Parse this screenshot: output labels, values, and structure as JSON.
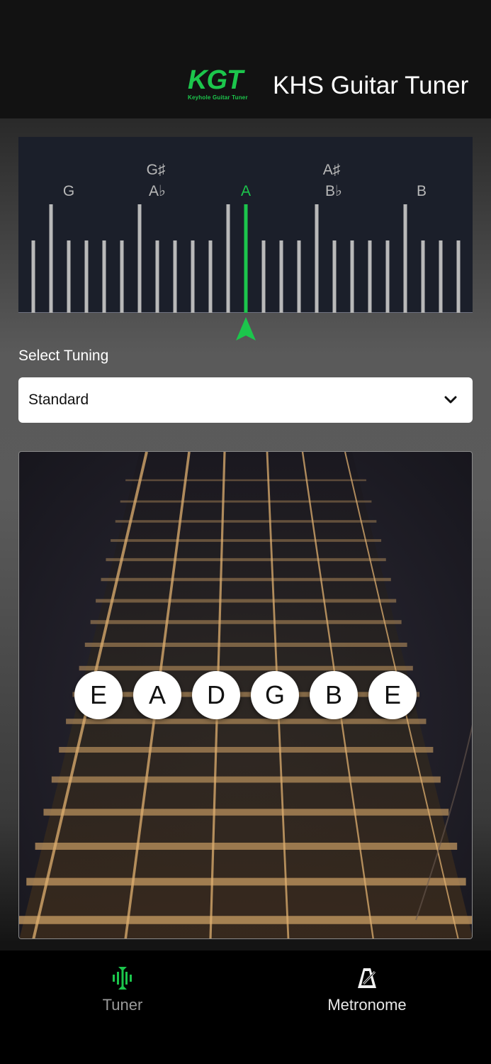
{
  "header": {
    "logo_text": "KGT",
    "logo_subtitle": "Keyhole Guitar Tuner",
    "title": "KHS Guitar Tuner"
  },
  "tuner": {
    "labels": {
      "g": "G",
      "ab_sharp": "G♯",
      "ab_flat": "A♭",
      "a": "A",
      "bb_sharp": "A♯",
      "bb_flat": "B♭",
      "b": "B"
    },
    "active_note": "A",
    "accent_color": "#1cc64c"
  },
  "select_tuning": {
    "label": "Select Tuning",
    "value": "Standard"
  },
  "strings": [
    "E",
    "A",
    "D",
    "G",
    "B",
    "E"
  ],
  "nav": {
    "tuner_label": "Tuner",
    "metronome_label": "Metronome"
  }
}
